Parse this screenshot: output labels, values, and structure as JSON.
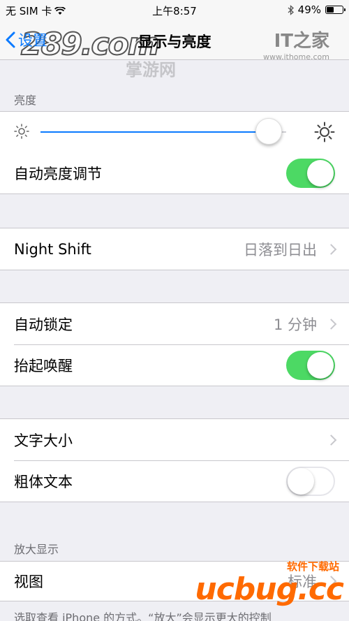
{
  "status_bar": {
    "carrier": "无 SIM 卡",
    "time": "上午8:57",
    "battery": "49%",
    "battery_level": 0.49
  },
  "nav": {
    "back_label": "设置",
    "title": "显示与亮度"
  },
  "watermarks": {
    "site_289": "289.com",
    "site_289_sub": "掌游网",
    "ithome_logo": "IT之家",
    "ithome_url": "www.ithome.com",
    "ucbug_brand": "ucbug.cc",
    "ucbug_sub": "软件下载站"
  },
  "brightness": {
    "header": "亮度",
    "slider_value": 0.93,
    "auto_label": "自动亮度调节",
    "auto_on": true
  },
  "night_shift": {
    "label": "Night Shift",
    "value": "日落到日出"
  },
  "lock": {
    "auto_lock_label": "自动锁定",
    "auto_lock_value": "1 分钟",
    "raise_to_wake_label": "抬起唤醒",
    "raise_to_wake_on": true
  },
  "text": {
    "text_size_label": "文字大小",
    "bold_text_label": "粗体文本",
    "bold_text_on": false
  },
  "zoom": {
    "header": "放大显示",
    "view_label": "视图",
    "view_value": "标准",
    "footer": "选取查看 iPhone 的方式。“放大”会显示更大的控制"
  },
  "colors": {
    "accent": "#0a7aff",
    "toggle_on": "#4cd964",
    "background": "#efeff4"
  }
}
